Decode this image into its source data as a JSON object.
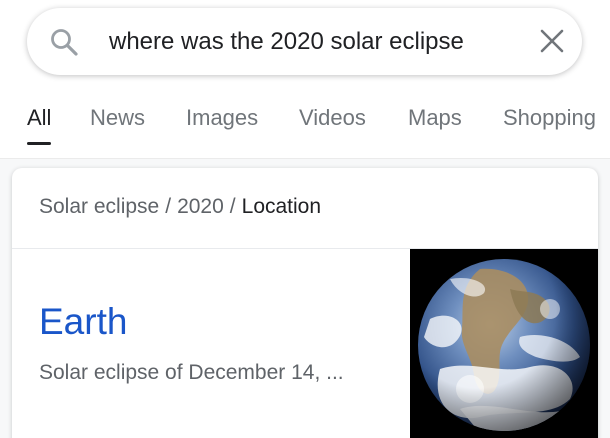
{
  "search": {
    "query": "where was the 2020 solar eclipse",
    "search_icon": "search-icon",
    "clear_icon": "close-icon"
  },
  "tabs": [
    {
      "label": "All",
      "active": true
    },
    {
      "label": "News",
      "active": false
    },
    {
      "label": "Images",
      "active": false
    },
    {
      "label": "Videos",
      "active": false
    },
    {
      "label": "Maps",
      "active": false
    },
    {
      "label": "Shopping",
      "active": false
    }
  ],
  "card": {
    "breadcrumb": [
      "Solar eclipse",
      "2020",
      "Location"
    ],
    "breadcrumb_separator": "/",
    "answer_title": "Earth",
    "answer_subtitle": "Solar eclipse of December 14, ...",
    "thumbnail_icon": "earth-globe-image"
  },
  "colors": {
    "link_blue": "#1a56c9",
    "text_primary": "#202124",
    "text_secondary": "#5f6368",
    "tab_inactive": "#70757a"
  }
}
